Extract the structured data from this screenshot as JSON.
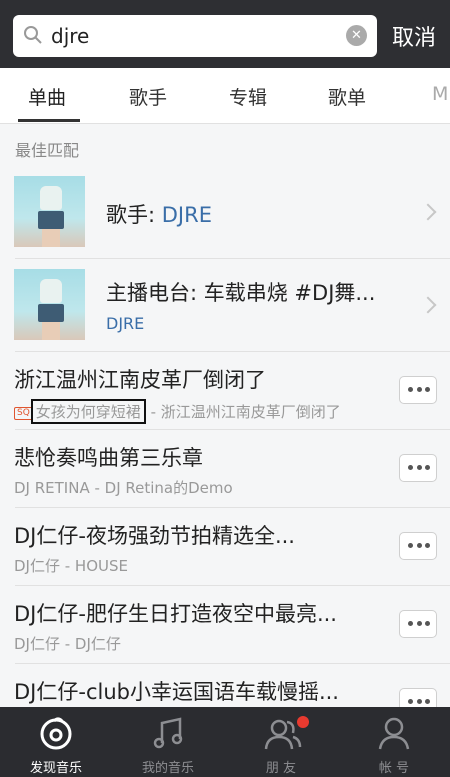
{
  "search": {
    "query": "djre",
    "cancel_label": "取消"
  },
  "tabs": [
    {
      "label": "单曲",
      "active": true
    },
    {
      "label": "歌手"
    },
    {
      "label": "专辑"
    },
    {
      "label": "歌单"
    },
    {
      "label": "M"
    }
  ],
  "best_match": {
    "title": "最佳匹配",
    "items": [
      {
        "label": "歌手: ",
        "name": "DJRE"
      },
      {
        "label": "主播电台: 车载串烧 #DJ舞...",
        "sub": "DJRE"
      }
    ]
  },
  "songs": [
    {
      "title": "浙江温州江南皮革厂倒闭了",
      "badge": "SQ",
      "highlight": "女孩为何穿短裙",
      "rest": " - 浙江温州江南皮革厂倒闭了"
    },
    {
      "title": "悲怆奏鸣曲第三乐章",
      "subtitle": "DJ RETINA - DJ Retina的Demo"
    },
    {
      "title": "DJ仁仔-夜场强劲节拍精选全...",
      "subtitle": "DJ仁仔 - HOUSE"
    },
    {
      "title": "DJ仁仔-肥仔生日打造夜空中最亮...",
      "subtitle": "DJ仁仔 - DJ仁仔"
    },
    {
      "title": "DJ仁仔-club小幸运国语车载慢摇...",
      "subtitle": ""
    }
  ],
  "bottom_nav": [
    {
      "label": "发现音乐",
      "icon": "netease-music-icon",
      "active": true
    },
    {
      "label": "我的音乐",
      "icon": "music-note-icon"
    },
    {
      "label": "朋 友",
      "icon": "friends-icon"
    },
    {
      "label": "帐 号",
      "icon": "account-icon"
    }
  ],
  "colors": {
    "accent": "#3a6ea8",
    "bar": "#2e2f33",
    "badge": "#e83a2f"
  }
}
